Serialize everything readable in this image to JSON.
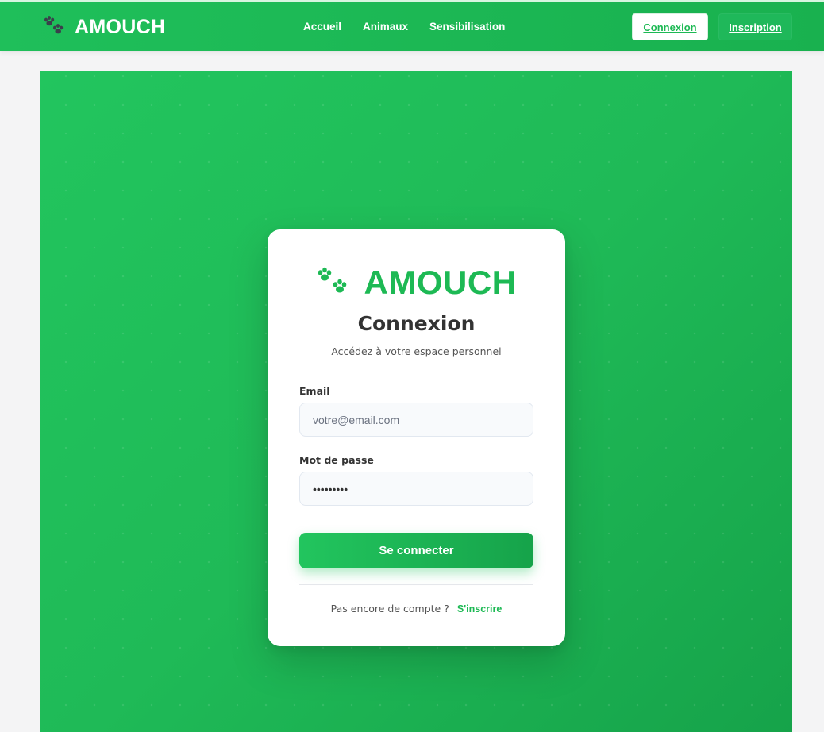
{
  "header": {
    "brand": "AMOUCH",
    "brand_icon": "paw-icon",
    "nav": [
      {
        "label": "Accueil"
      },
      {
        "label": "Animaux"
      },
      {
        "label": "Sensibilisation"
      }
    ],
    "login_label": "Connexion",
    "signup_label": "Inscription"
  },
  "card": {
    "brand": "AMOUCH",
    "brand_icon": "paw-icon",
    "title": "Connexion",
    "subtitle": "Accédez à votre espace personnel",
    "email_label": "Email",
    "email_placeholder": "votre@email.com",
    "email_value": "",
    "password_label": "Mot de passe",
    "password_value": "password1",
    "submit_label": "Se connecter",
    "footer_text": "Pas encore de compte ?",
    "footer_link": "S'inscrire"
  },
  "colors": {
    "brand_green": "#1db954",
    "hero_start": "#22c55e",
    "hero_end": "#16a34a",
    "header_paw": "#3a3f4b"
  }
}
